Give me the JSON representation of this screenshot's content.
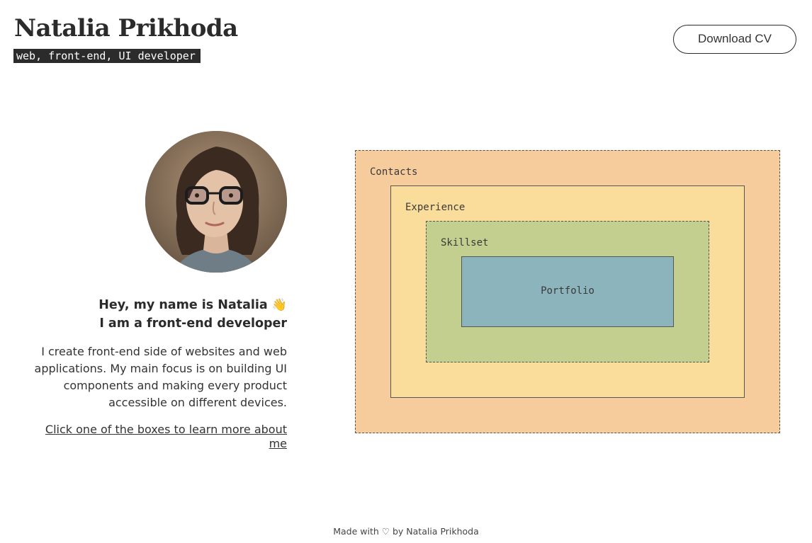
{
  "header": {
    "name": "Natalia Prikhoda",
    "tagline": "web, front-end, UI developer",
    "download_cv_label": "Download CV"
  },
  "intro": {
    "greeting_line1": "Hey, my name is Natalia",
    "wave_icon": "👋",
    "greeting_line2": "I am a front-end developer",
    "bio": "I create front-end side of websites and web applications. My main focus is on building UI components and making every product accessible on different devices.",
    "cta_link": "Click one of the boxes to learn more about me"
  },
  "boxes": {
    "contacts": "Contacts",
    "experience": "Experience",
    "skillset": "Skillset",
    "portfolio": "Portfolio"
  },
  "footer": {
    "made_with": "Made with",
    "heart_icon": "♡",
    "by": "by Natalia Prikhoda"
  },
  "colors": {
    "contacts_bg": "#f7cc9c",
    "experience_bg": "#fadc9b",
    "skillset_bg": "#c3cf8e",
    "portfolio_bg": "#8bb4bd",
    "dark": "#2b2b2b"
  }
}
